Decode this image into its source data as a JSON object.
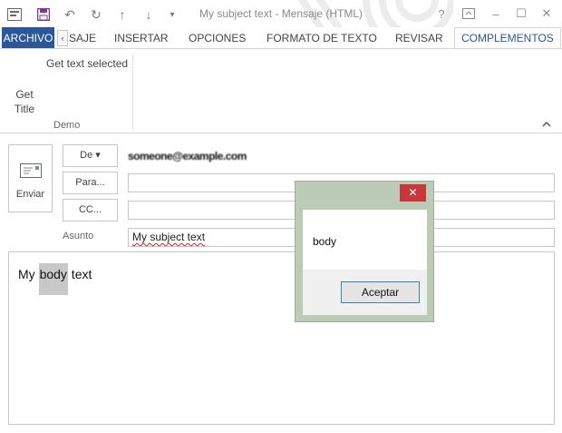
{
  "window": {
    "title": "My subject text - Mensaje (HTML)",
    "quick_access": [
      "save-icon",
      "undo-icon",
      "redo-icon",
      "up-arrow-icon",
      "down-arrow-icon",
      "customize-icon"
    ],
    "controls": {
      "help": "?",
      "minimize": "–",
      "maximize": "☐",
      "close": "✕"
    }
  },
  "tabs": {
    "archivo": "ARCHIVO",
    "mensaje": "SAJE",
    "insertar": "INSERTAR",
    "opciones": "OPCIONES",
    "formato": "FORMATO DE TEXTO",
    "revisar": "REVISAR",
    "complementos": "COMPLEMENTOS",
    "scroll_left": "‹"
  },
  "ribbon": {
    "get_text_selected": "Get text selected",
    "get_title_line1": "Get",
    "get_title_line2": "Title",
    "group_label": "Demo",
    "collapse": "^"
  },
  "compose": {
    "send_label": "Enviar",
    "from_label": "De ▾",
    "from_value": "someone@example.com",
    "to_label": "Para...",
    "cc_label": "CC...",
    "subject_label": "Asunto",
    "subject_value": "My subject text",
    "body_before": "My ",
    "body_selected": "body",
    "body_after": " text"
  },
  "dialog": {
    "message": "body",
    "ok_label": "Aceptar",
    "close": "✕"
  },
  "colors": {
    "accent": "#2b579a",
    "dialog_frame": "#bccbb6",
    "close_red": "#c7383a",
    "selection": "#c8c8c8"
  }
}
